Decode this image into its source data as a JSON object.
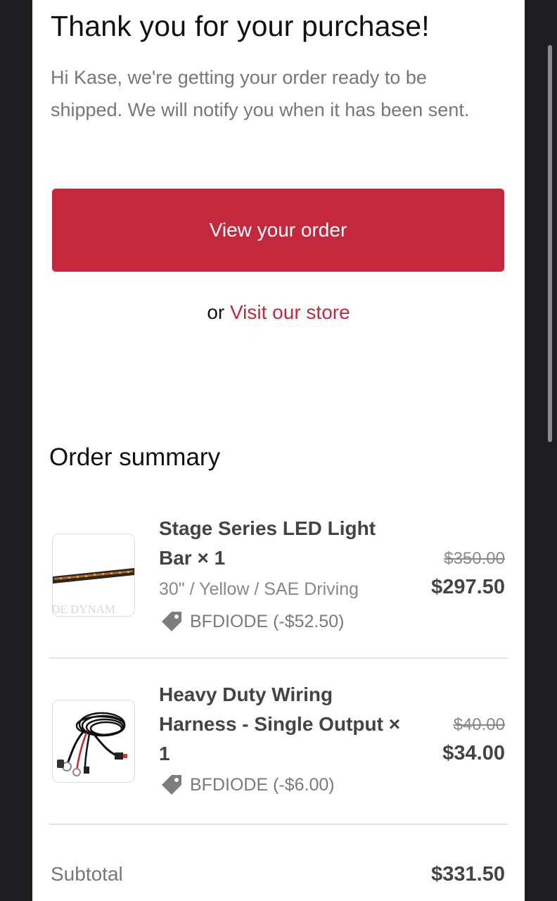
{
  "header": {
    "title": "Thank you for your purchase!",
    "intro": "Hi Kase, we're getting your order ready to be shipped. We will notify you when it has been sent."
  },
  "actions": {
    "view_order_label": "View your order",
    "or_text": "or",
    "visit_store_label": "Visit our store"
  },
  "summary": {
    "title": "Order summary",
    "items": [
      {
        "name": "Stage Series LED Light Bar × 1",
        "variant": "30\" / Yellow / SAE Driving",
        "discount": "BFDIODE (-$52.50)",
        "original_price": "$350.00",
        "price": "$297.50",
        "image_icon": "light-bar-image",
        "image_text": "DE DYNAM"
      },
      {
        "name": "Heavy Duty Wiring Harness - Single Output × 1",
        "discount": "BFDIODE (-$6.00)",
        "original_price": "$40.00",
        "price": "$34.00",
        "image_icon": "wiring-harness-image"
      }
    ],
    "subtotal_label": "Subtotal",
    "subtotal_value": "$331.50"
  },
  "colors": {
    "accent": "#c4283c",
    "background": "#ffffff",
    "frame": "#1e1e20"
  }
}
